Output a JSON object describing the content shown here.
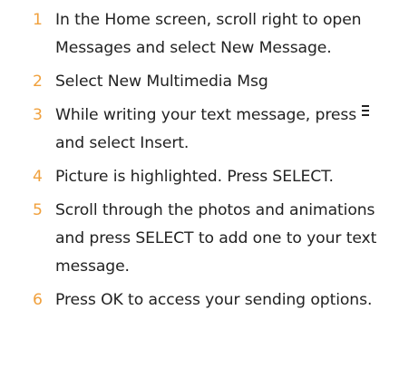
{
  "steps": [
    {
      "number": "1",
      "text": "In the Home screen, scroll right to open Messages and select New Message."
    },
    {
      "number": "2",
      "text": "Select New Multimedia Msg"
    },
    {
      "number": "3",
      "text_before_icon": "While writing your text message, press",
      "icon": "menu-icon",
      "text_after_icon": "and select Insert."
    },
    {
      "number": "4",
      "text": "Picture is highlighted. Press SELECT."
    },
    {
      "number": "5",
      "text": "Scroll through the photos and animations and press SELECT to add one to your text message."
    },
    {
      "number": "6",
      "text": "Press OK to access your sending options."
    }
  ],
  "colors": {
    "step_number": "#f0a03c",
    "body_text": "#222222"
  }
}
